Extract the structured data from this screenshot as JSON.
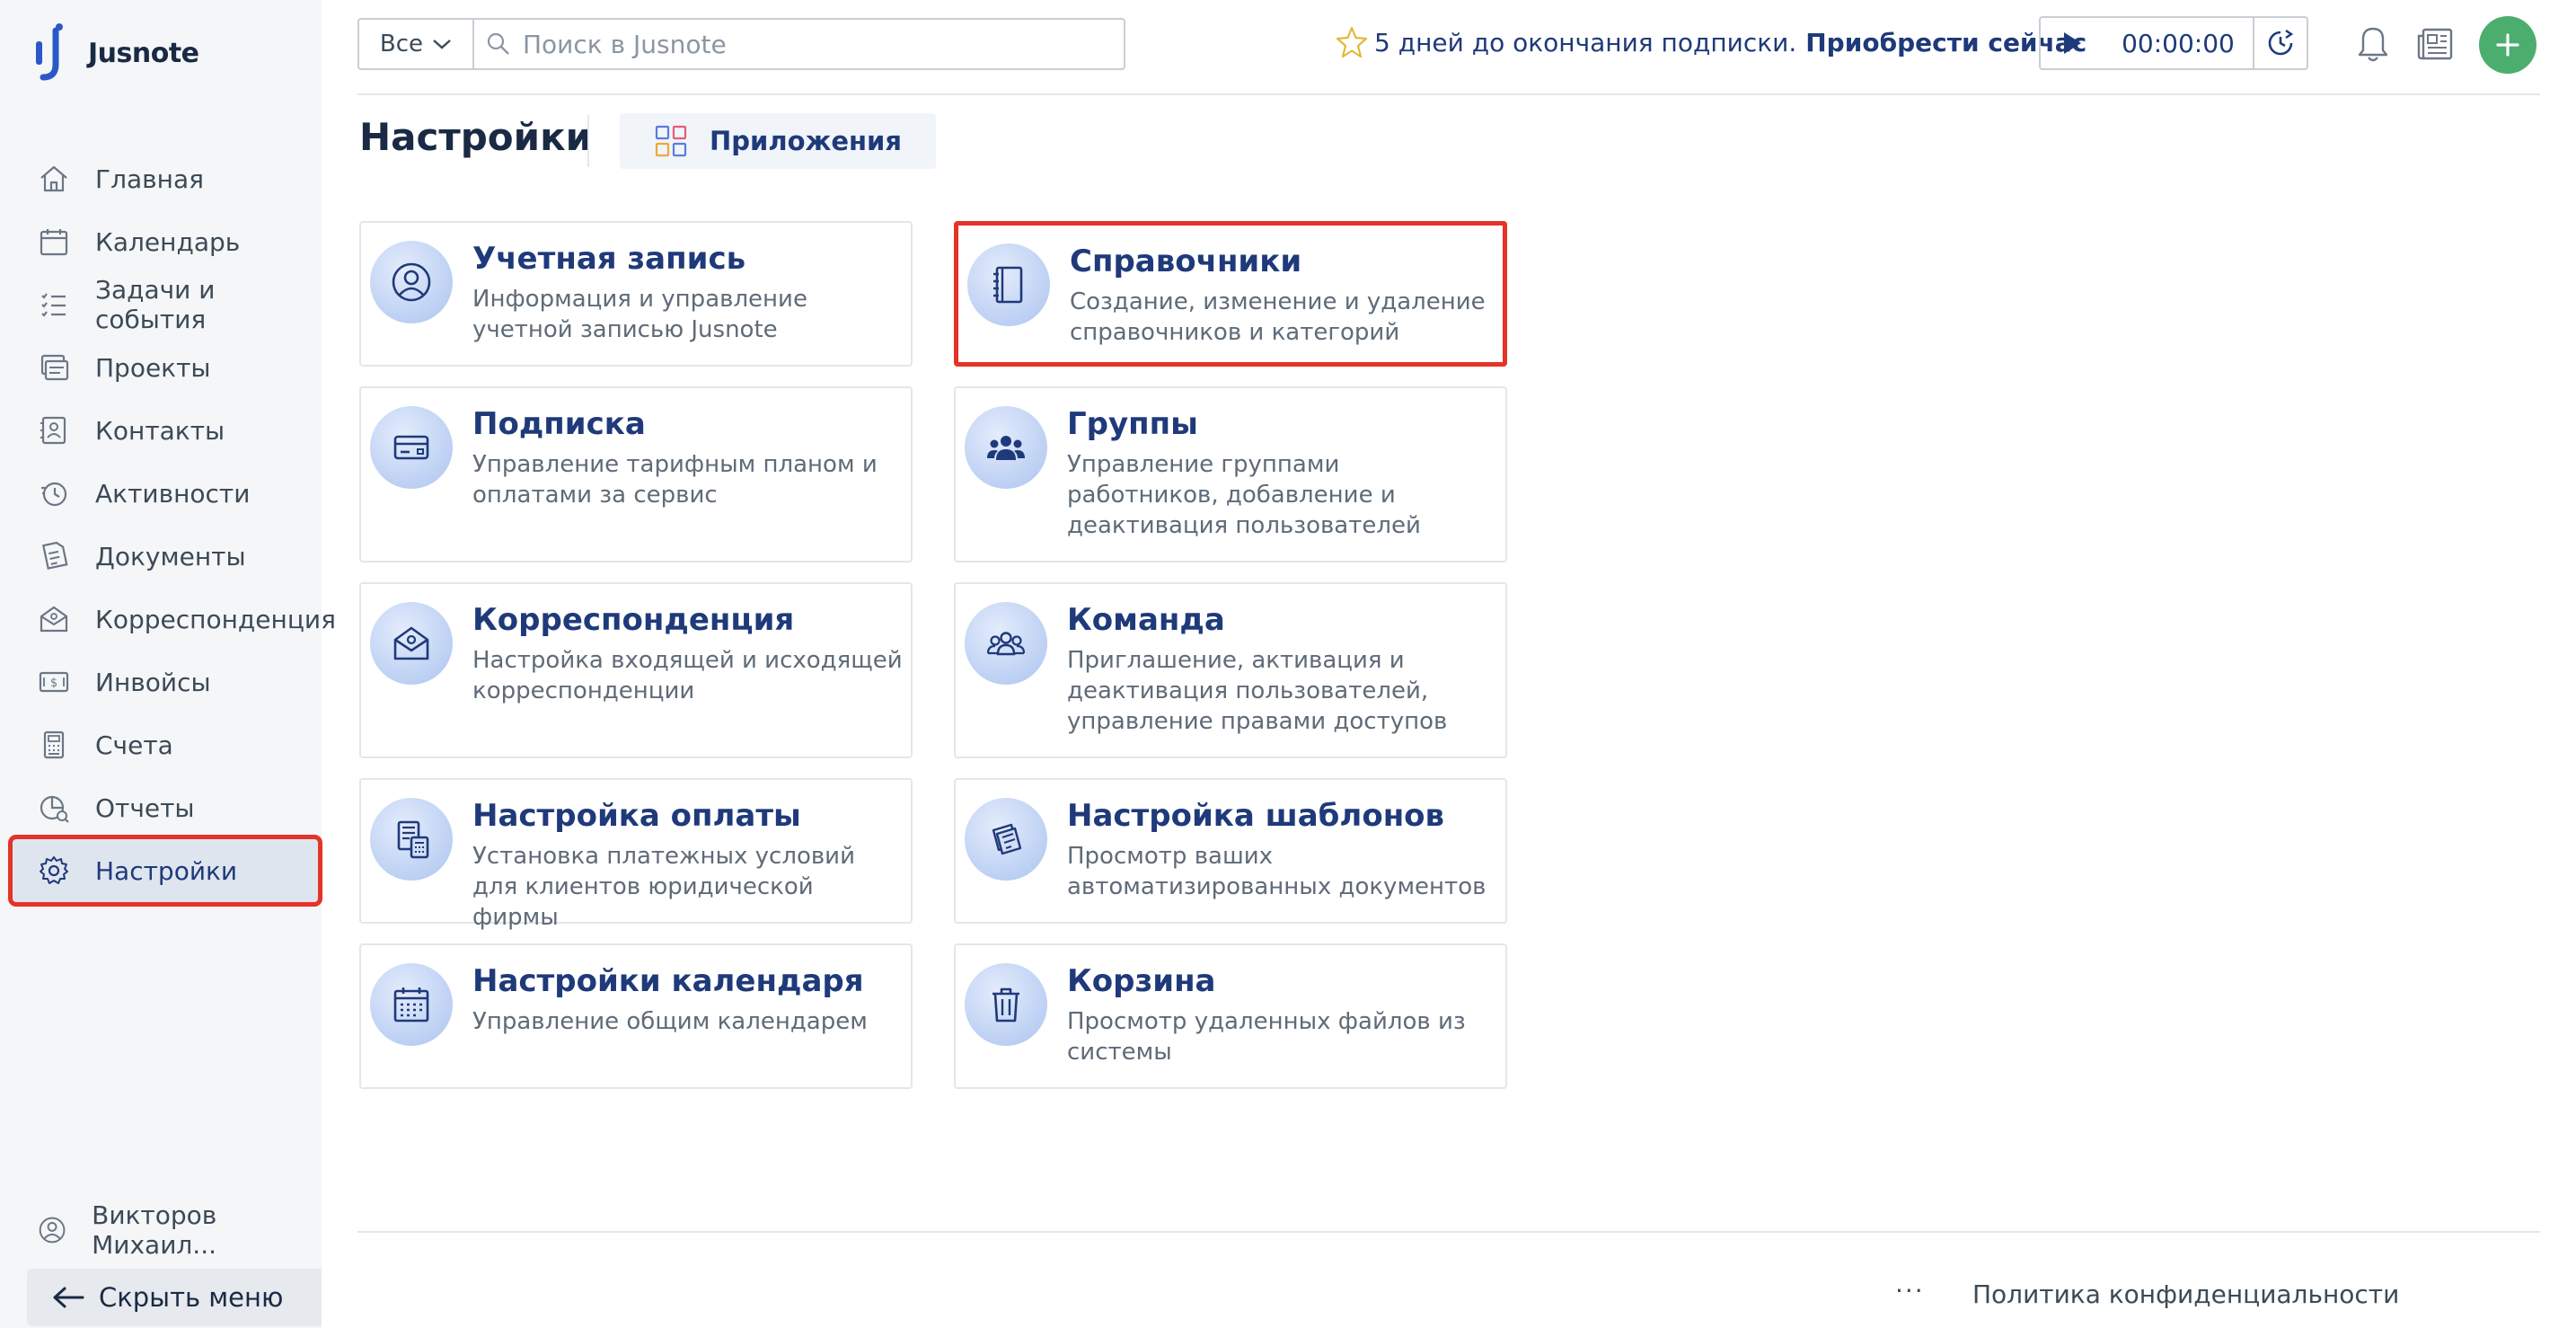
{
  "app": {
    "name": "Jusnote"
  },
  "sidebar": {
    "items": [
      {
        "label": "Главная",
        "icon": "home-icon"
      },
      {
        "label": "Календарь",
        "icon": "calendar-icon"
      },
      {
        "label": "Задачи и события",
        "icon": "tasks-icon"
      },
      {
        "label": "Проекты",
        "icon": "projects-icon"
      },
      {
        "label": "Контакты",
        "icon": "contacts-icon"
      },
      {
        "label": "Активности",
        "icon": "activity-icon"
      },
      {
        "label": "Документы",
        "icon": "documents-icon"
      },
      {
        "label": "Корреспонденция",
        "icon": "correspondence-icon"
      },
      {
        "label": "Инвойсы",
        "icon": "invoices-icon"
      },
      {
        "label": "Счета",
        "icon": "accounts-icon"
      },
      {
        "label": "Отчеты",
        "icon": "reports-icon"
      },
      {
        "label": "Настройки",
        "icon": "settings-icon",
        "active": true
      }
    ],
    "user_name": "Викторов Михаил...",
    "hide_menu_label": "Скрыть меню"
  },
  "topbar": {
    "search_filter": "Все",
    "search_placeholder": "Поиск в Jusnote",
    "promo_text": "5 дней до окончания подписки.",
    "promo_link": "Приобрести сейчас",
    "timer_value": "00:00:00"
  },
  "page": {
    "title": "Настройки",
    "apps_tab": "Приложения"
  },
  "cards": [
    {
      "title": "Учетная запись",
      "desc": "Информация и управление учетной записью Jusnote",
      "icon": "account-icon"
    },
    {
      "title": "Справочники",
      "desc": "Создание, изменение и удаление справочников и категорий",
      "icon": "directory-book-icon",
      "highlighted": true
    },
    {
      "title": "Подписка",
      "desc": "Управление тарифным планом и оплатами за сервис",
      "icon": "subscription-card-icon"
    },
    {
      "title": "Группы",
      "desc": "Управление группами работников, добавление и деактивация пользователей",
      "icon": "groups-icon"
    },
    {
      "title": "Корреспонденция",
      "desc": "Настройка входящей и исходящей корреспонденции",
      "icon": "mail-icon"
    },
    {
      "title": "Команда",
      "desc": "Приглашение, активация и деактивация пользователей, управление правами доступов",
      "icon": "team-icon"
    },
    {
      "title": "Настройка оплаты",
      "desc": "Установка платежных условий для клиентов юридической фирмы",
      "icon": "payment-calculator-icon"
    },
    {
      "title": "Настройка шаблонов",
      "desc": "Просмотр ваших автоматизированных документов",
      "icon": "templates-icon"
    },
    {
      "title": "Настройки календаря",
      "desc": "Управление общим календарем",
      "icon": "calendar-settings-icon"
    },
    {
      "title": "Корзина",
      "desc": "Просмотр удаленных файлов из системы",
      "icon": "trash-icon"
    }
  ],
  "footer": {
    "more": "···",
    "privacy": "Политика конфиденциальности"
  }
}
